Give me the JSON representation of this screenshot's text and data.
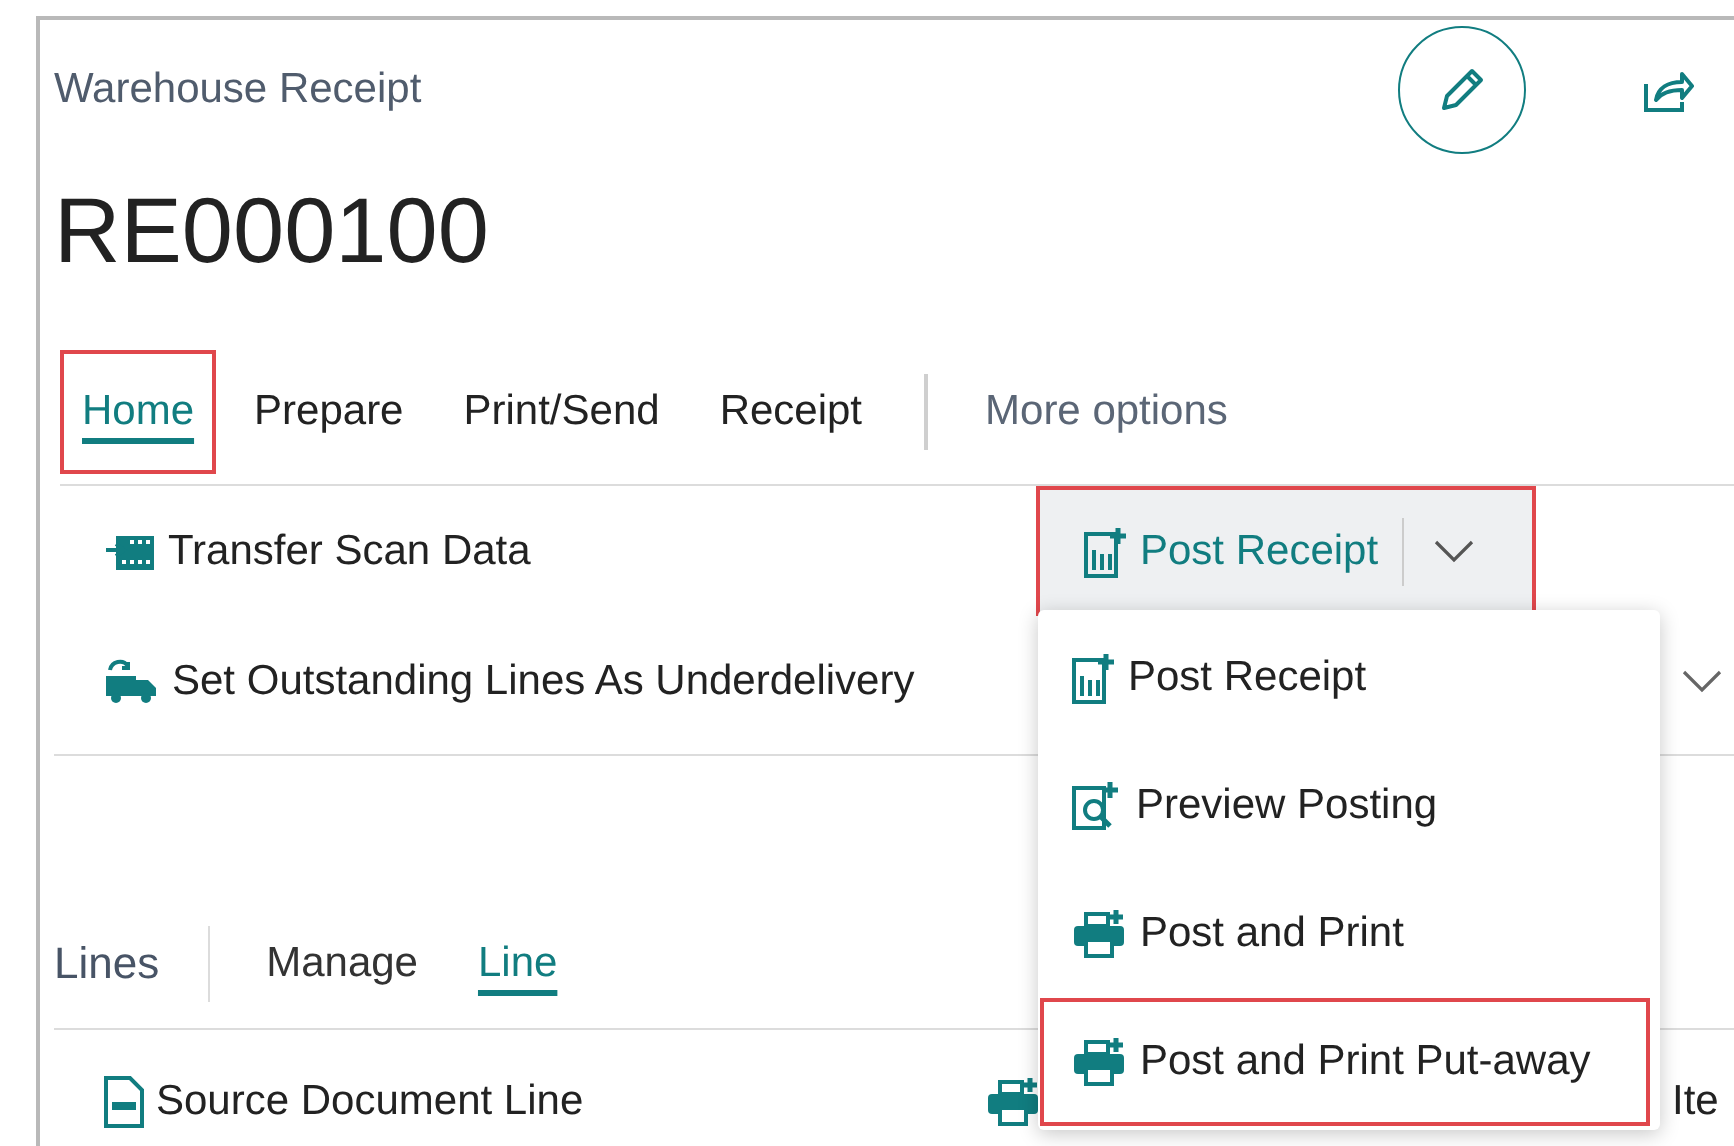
{
  "header": {
    "title": "Warehouse Receipt",
    "record_no": "RE000100"
  },
  "tabs": [
    {
      "label": "Home",
      "selected": true,
      "highlighted": true,
      "kind": "tab"
    },
    {
      "label": "Prepare",
      "selected": false,
      "highlighted": false,
      "kind": "tab"
    },
    {
      "label": "Print/Send",
      "selected": false,
      "highlighted": false,
      "kind": "tab"
    },
    {
      "label": "Receipt",
      "selected": false,
      "highlighted": false,
      "kind": "tab"
    },
    {
      "label": "More options",
      "selected": false,
      "highlighted": false,
      "kind": "more"
    }
  ],
  "actions": [
    {
      "label": "Transfer Scan Data",
      "kind": "scan"
    },
    {
      "label": "Set Outstanding Lines As Underdelivery",
      "kind": "truck"
    }
  ],
  "split_button": {
    "label": "Post Receipt",
    "highlighted": true
  },
  "menu": [
    {
      "label": "Post Receipt",
      "kind": "post",
      "highlighted": false
    },
    {
      "label": "Preview Posting",
      "kind": "preview",
      "highlighted": false
    },
    {
      "label": "Post and Print",
      "kind": "printer",
      "highlighted": false
    },
    {
      "label": "Post and Print Put-away",
      "kind": "printer",
      "highlighted": true
    }
  ],
  "lines": {
    "title": "Lines",
    "tabs": [
      {
        "label": "Manage",
        "selected": false
      },
      {
        "label": "Line",
        "selected": true
      }
    ],
    "actions": [
      {
        "label": "Source Document Line",
        "kind": "document"
      },
      {
        "kind": "printer"
      },
      {
        "label": "Ite"
      }
    ]
  }
}
